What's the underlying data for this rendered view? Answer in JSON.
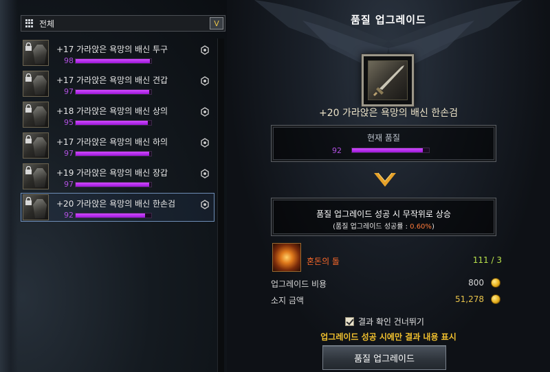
{
  "filter": {
    "label": "전체",
    "dropdown_glyph": "V"
  },
  "items": [
    {
      "name": "+17 가라앉은 욕망의 배신 투구",
      "quality": 98
    },
    {
      "name": "+17 가라앉은 욕망의 배신 견갑",
      "quality": 97
    },
    {
      "name": "+18 가라앉은 욕망의 배신 상의",
      "quality": 95
    },
    {
      "name": "+17 가라앉은 욕망의 배신 하의",
      "quality": 97
    },
    {
      "name": "+19 가라앉은 욕망의 배신 장갑",
      "quality": 97
    },
    {
      "name": "+20 가라앉은 욕망의 배신 한손검",
      "quality": 92,
      "selected": true
    }
  ],
  "panel": {
    "title": "품질 업그레이드",
    "item_name": "+20 가라앉은 욕망의 배신 한손검",
    "current_quality_label": "현재 품질",
    "current_quality": 92,
    "info_line1": "품질 업그레이드 성공 시 무작위로 상승",
    "info_line2_prefix": "(품질 업그레이드 성공률 : ",
    "info_line2_pct": "0.60%",
    "info_line2_suffix": ")",
    "material_name": "혼돈의 돌",
    "material_count": "111 / 3",
    "cost_label": "업그레이드 비용",
    "cost_value": "800",
    "owned_label": "소지 금액",
    "owned_value": "51,278",
    "skip_label": "결과 확인 건너뛰기",
    "skip_note": "업그레이드 성공 시에만 결과 내용 표시",
    "button_label": "품질 업그레이드"
  },
  "colors": {
    "accent_purple": "#b050e0",
    "gold": "#e8c34a",
    "material": "#ff6a2a",
    "count_green": "#b9e24a"
  },
  "icons": [
    "grid-icon",
    "chevron-down-icon",
    "lock-icon",
    "equipment-mark-icon",
    "gold-coin-icon",
    "chevron-arrow-icon",
    "checkbox-icon"
  ]
}
